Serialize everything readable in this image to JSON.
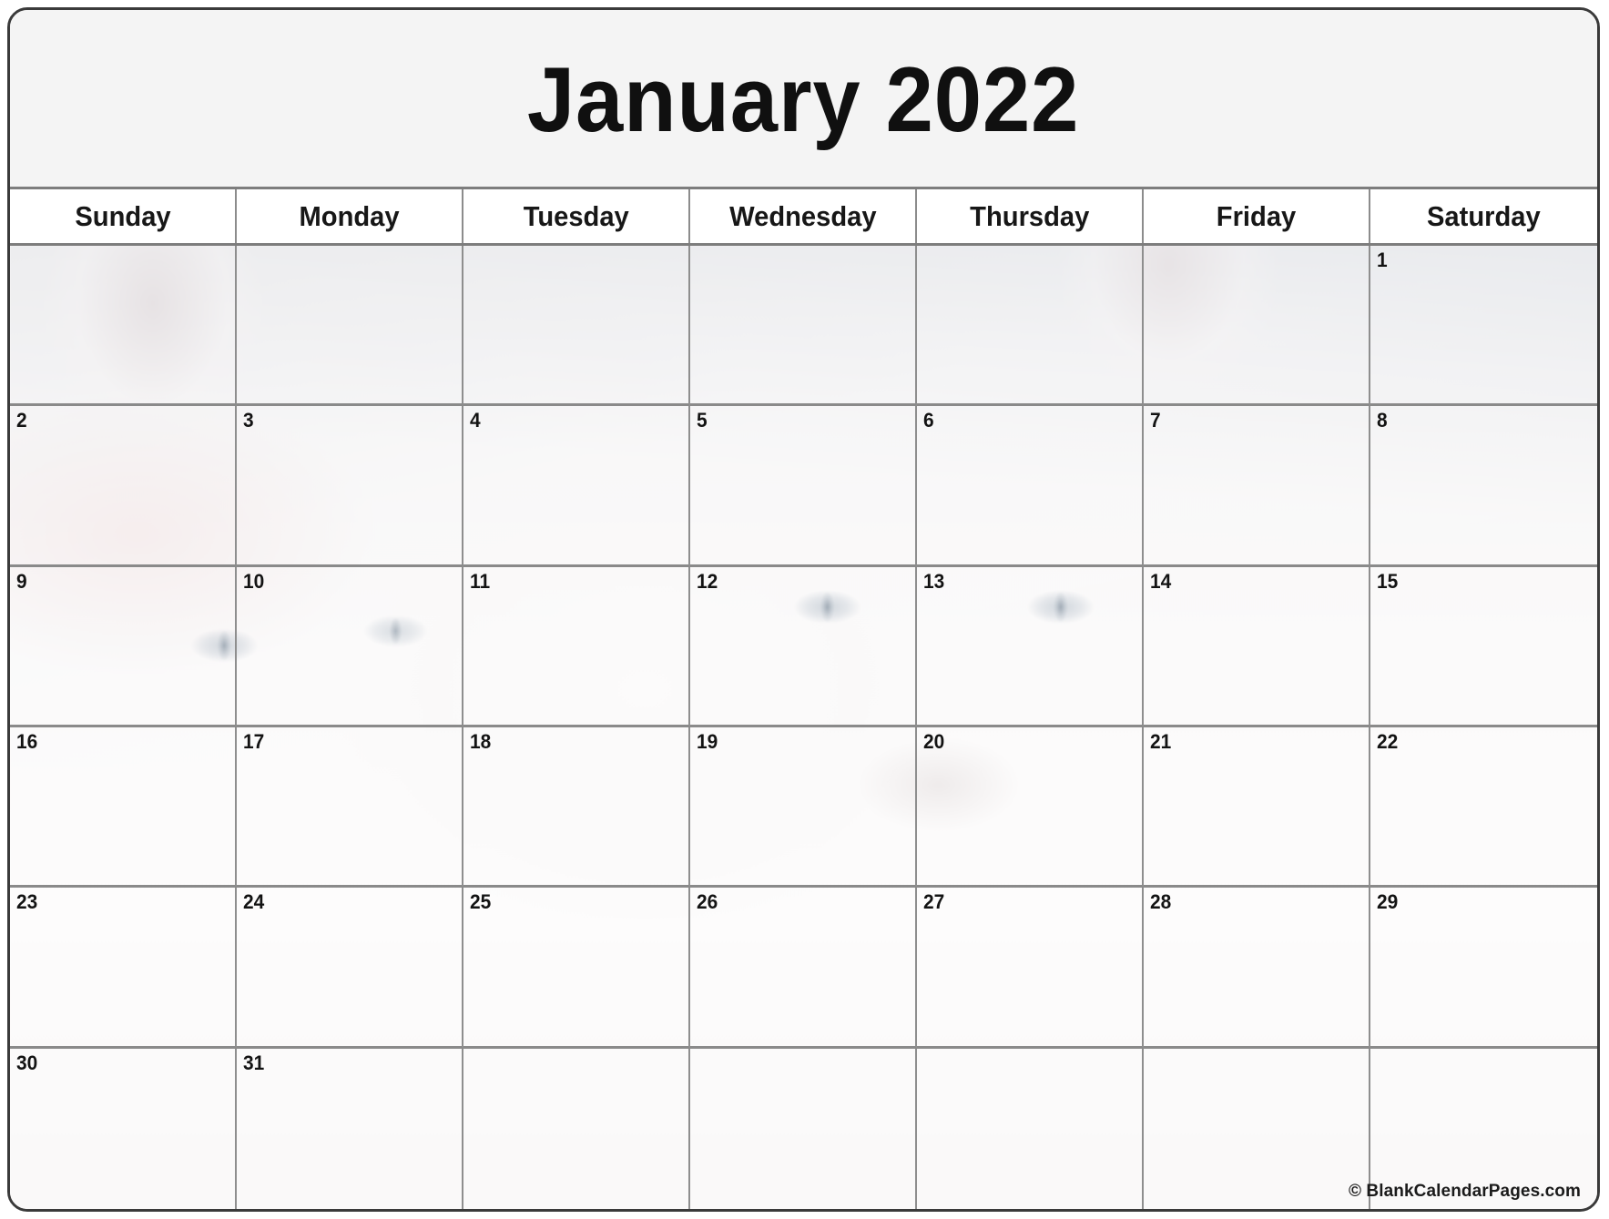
{
  "calendar": {
    "title": "January 2022",
    "month": "January",
    "year": "2022",
    "weekdays": [
      "Sunday",
      "Monday",
      "Tuesday",
      "Wednesday",
      "Thursday",
      "Friday",
      "Saturday"
    ],
    "weeks": [
      [
        "",
        "",
        "",
        "",
        "",
        "",
        "1"
      ],
      [
        "2",
        "3",
        "4",
        "5",
        "6",
        "7",
        "8"
      ],
      [
        "9",
        "10",
        "11",
        "12",
        "13",
        "14",
        "15"
      ],
      [
        "16",
        "17",
        "18",
        "19",
        "20",
        "21",
        "22"
      ],
      [
        "23",
        "24",
        "25",
        "26",
        "27",
        "28",
        "29"
      ],
      [
        "30",
        "31",
        "",
        "",
        "",
        "",
        ""
      ]
    ],
    "background_image": "white-kitten-photo-faded",
    "credit": "© BlankCalendarPages.com",
    "colors": {
      "page_background": "#ffffff",
      "frame_border": "#3a3a3a",
      "title_background": "#f4f4f4",
      "title_text": "#101010",
      "weekday_background": "#ffffff",
      "weekday_text": "#171717",
      "grid_line": "#8c8c8c",
      "day_number_text": "#131313",
      "credit_text": "#1b1b1b"
    }
  }
}
